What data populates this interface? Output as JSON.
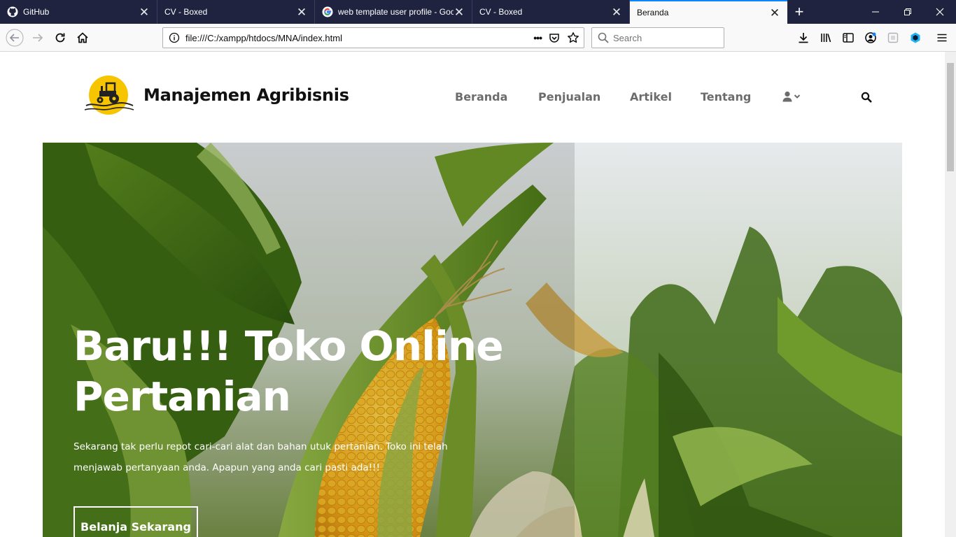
{
  "browser": {
    "tabs": [
      {
        "label": "GitHub",
        "icon": "github-icon",
        "active": false
      },
      {
        "label": "CV - Boxed",
        "icon": "",
        "active": false
      },
      {
        "label": "web template user profile - Goo",
        "icon": "google-icon",
        "active": false
      },
      {
        "label": "CV - Boxed",
        "icon": "",
        "active": false
      },
      {
        "label": "Beranda",
        "icon": "",
        "active": true
      }
    ],
    "new_tab": "+",
    "url": "file:///C:/xampp/htdocs/MNA/index.html",
    "url_actions": "•••",
    "search_placeholder": "Search",
    "accent_color": "#0a84ff",
    "tabbar_color": "#202340"
  },
  "site": {
    "brand": "Manajemen Agribisnis",
    "logo_color": "#f7c500",
    "nav": [
      {
        "label": "Beranda"
      },
      {
        "label": "Penjualan"
      },
      {
        "label": "Artikel"
      },
      {
        "label": "Tentang"
      }
    ]
  },
  "hero": {
    "title_line1": "Baru!!! Toko Online",
    "title_line2": "Pertanian",
    "text_line1": "Sekarang tak perlu repot cari-cari alat dan bahan utuk pertanian. Toko ini telah",
    "text_line2": "menjawab pertanyaan anda. Apapun yang anda cari pasti ada!!!",
    "button": "Belanja Sekarang"
  }
}
